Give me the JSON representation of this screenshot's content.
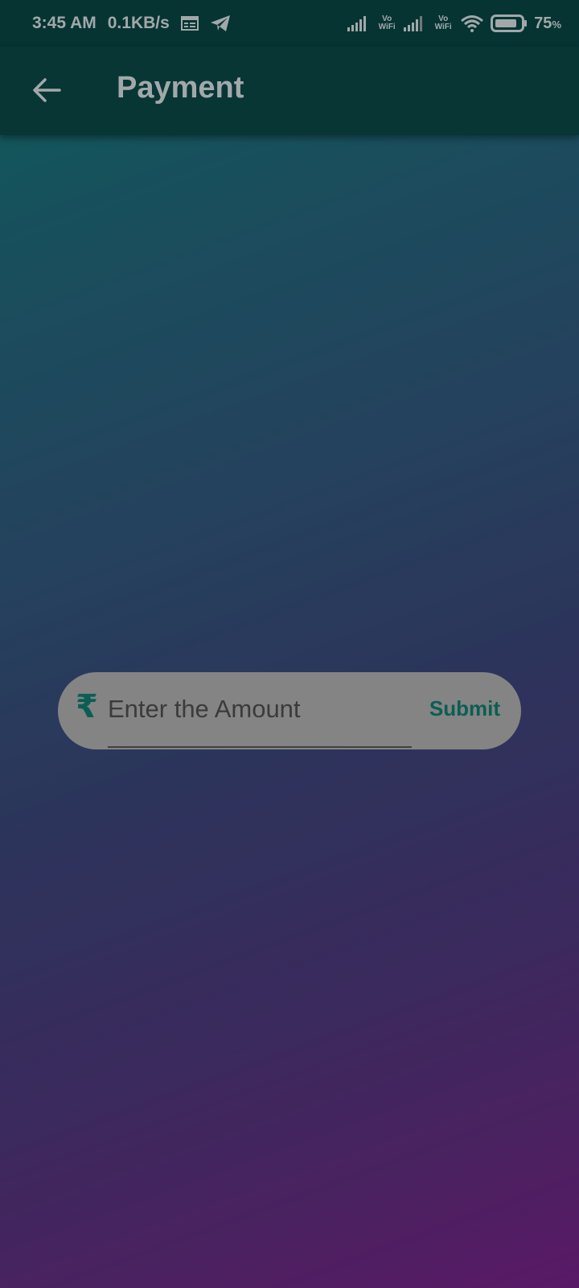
{
  "status_bar": {
    "time": "3:45 AM",
    "speed": "0.1KB/s",
    "vowifi_1": "Vo\nWiFi",
    "vowifi_2": "Vo\nWiFi",
    "battery": "75",
    "battery_unit": "%",
    "icons": [
      "calendar-icon",
      "telegram-icon",
      "signal-icon",
      "signal-icon",
      "wifi-icon",
      "battery-icon"
    ]
  },
  "app_bar": {
    "title": "Payment",
    "back_icon": "arrow-back-icon"
  },
  "payment": {
    "currency_symbol": "₹",
    "placeholder": "Enter the Amount",
    "value": "",
    "submit_label": "Submit"
  },
  "colors": {
    "accent": "#0d6b5f",
    "app_bar": "#083e3d",
    "field_bg": "#979797",
    "gradient_top": "#0e6a66",
    "gradient_bottom": "#661c74"
  }
}
